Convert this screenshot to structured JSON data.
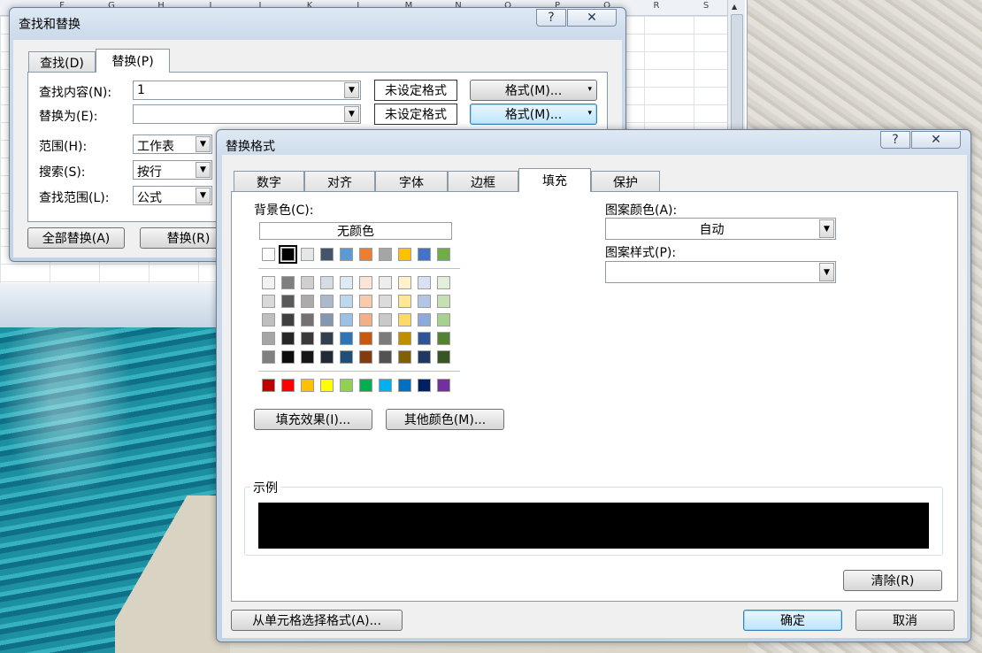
{
  "excel": {
    "columns": [
      "F",
      "G",
      "H",
      "I",
      "J",
      "K",
      "L",
      "M",
      "N",
      "O",
      "P",
      "Q",
      "R",
      "S"
    ]
  },
  "find_replace": {
    "title": "查找和替换",
    "tabs": [
      "查找(D)",
      "替换(P)"
    ],
    "active_tab": "替换(P)",
    "find_label": "查找内容(N):",
    "find_value": "1",
    "replace_label": "替换为(E):",
    "replace_value": "",
    "no_format_1": "未设定格式",
    "no_format_2": "未设定格式",
    "format_btn_1": "格式(M)...",
    "format_btn_2": "格式(M)...",
    "scope_label": "范围(H):",
    "scope_value": "工作表",
    "search_label": "搜索(S):",
    "search_value": "按行",
    "lookin_label": "查找范围(L):",
    "lookin_value": "公式",
    "replace_all": "全部替换(A)",
    "replace": "替换(R)"
  },
  "replace_format": {
    "title": "替换格式",
    "tabs": [
      "数字",
      "对齐",
      "字体",
      "边框",
      "填充",
      "保护"
    ],
    "active_tab": "填充",
    "bg_color_label": "背景色(C):",
    "no_color": "无颜色",
    "fill_effects": "填充效果(I)...",
    "more_colors": "其他颜色(M)...",
    "pattern_color_label": "图案颜色(A):",
    "pattern_color_value": "自动",
    "pattern_style_label": "图案样式(P):",
    "pattern_style_value": "",
    "sample_label": "示例",
    "sample_color": "#000000",
    "clear": "清除(R)",
    "from_cell": "从单元格选择格式(A)...",
    "ok": "确定",
    "cancel": "取消",
    "selected_color": "#000000",
    "palette_theme_top": [
      "#FFFFFF",
      "#000000",
      "#E7E6E6",
      "#44546A",
      "#5B9BD5",
      "#ED7D31",
      "#A5A5A5",
      "#FFC000",
      "#4472C4",
      "#70AD47"
    ],
    "palette_tints": [
      [
        "#F2F2F2",
        "#7F7F7F",
        "#D0CECE",
        "#D6DCE4",
        "#DDEBF7",
        "#FCE4D6",
        "#EDEDED",
        "#FFF2CC",
        "#D9E1F2",
        "#E2EFDA"
      ],
      [
        "#D9D9D9",
        "#595959",
        "#AEAAAA",
        "#ACB9CA",
        "#BDD7EE",
        "#F8CBAD",
        "#DBDBDB",
        "#FFE699",
        "#B4C6E7",
        "#C6E0B4"
      ],
      [
        "#BFBFBF",
        "#404040",
        "#757171",
        "#8497B0",
        "#9BC2E6",
        "#F4B084",
        "#C9C9C9",
        "#FFD966",
        "#8EA9DB",
        "#A9D08E"
      ],
      [
        "#A6A6A6",
        "#262626",
        "#3A3838",
        "#333F4F",
        "#2F75B5",
        "#C65911",
        "#7B7B7B",
        "#BF8F00",
        "#305496",
        "#548235"
      ],
      [
        "#808080",
        "#0D0D0D",
        "#161616",
        "#222B35",
        "#1F4E78",
        "#833C0C",
        "#525252",
        "#806000",
        "#203764",
        "#375623"
      ]
    ],
    "palette_standard": [
      "#C00000",
      "#FF0000",
      "#FFC000",
      "#FFFF00",
      "#92D050",
      "#00B050",
      "#00B0F0",
      "#0070C0",
      "#002060",
      "#7030A0"
    ]
  }
}
